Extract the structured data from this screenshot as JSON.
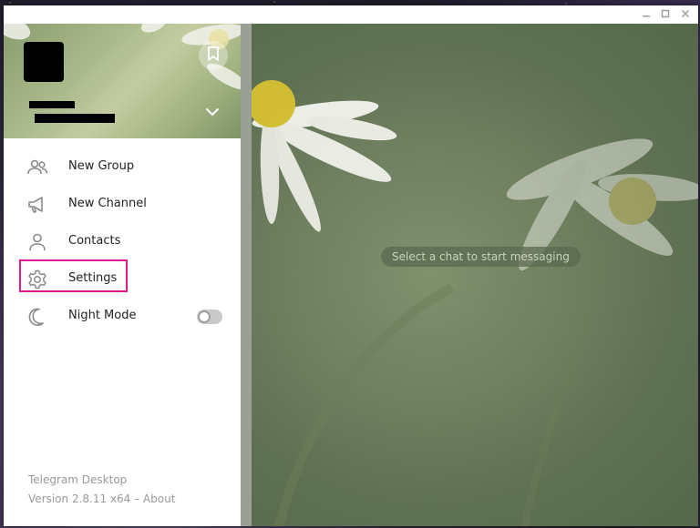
{
  "window": {
    "controls": {
      "minimize_icon": "minimize-icon",
      "maximize_icon": "maximize-icon",
      "close_icon": "close-icon"
    }
  },
  "sidebar": {
    "menu": [
      {
        "label": "New Group",
        "icon": "group-icon"
      },
      {
        "label": "New Channel",
        "icon": "megaphone-icon"
      },
      {
        "label": "Contacts",
        "icon": "person-icon"
      },
      {
        "label": "Settings",
        "icon": "gear-icon"
      },
      {
        "label": "Night Mode",
        "icon": "moon-icon"
      }
    ],
    "night_mode_enabled": false,
    "footer": {
      "app_name": "Telegram Desktop",
      "version": "Version 2.8.11 x64 – About"
    }
  },
  "chat": {
    "empty_hint": "Select a chat to start messaging"
  },
  "colors": {
    "highlight": "#e0198c",
    "text": "#222222",
    "muted": "#9a9a9a"
  }
}
